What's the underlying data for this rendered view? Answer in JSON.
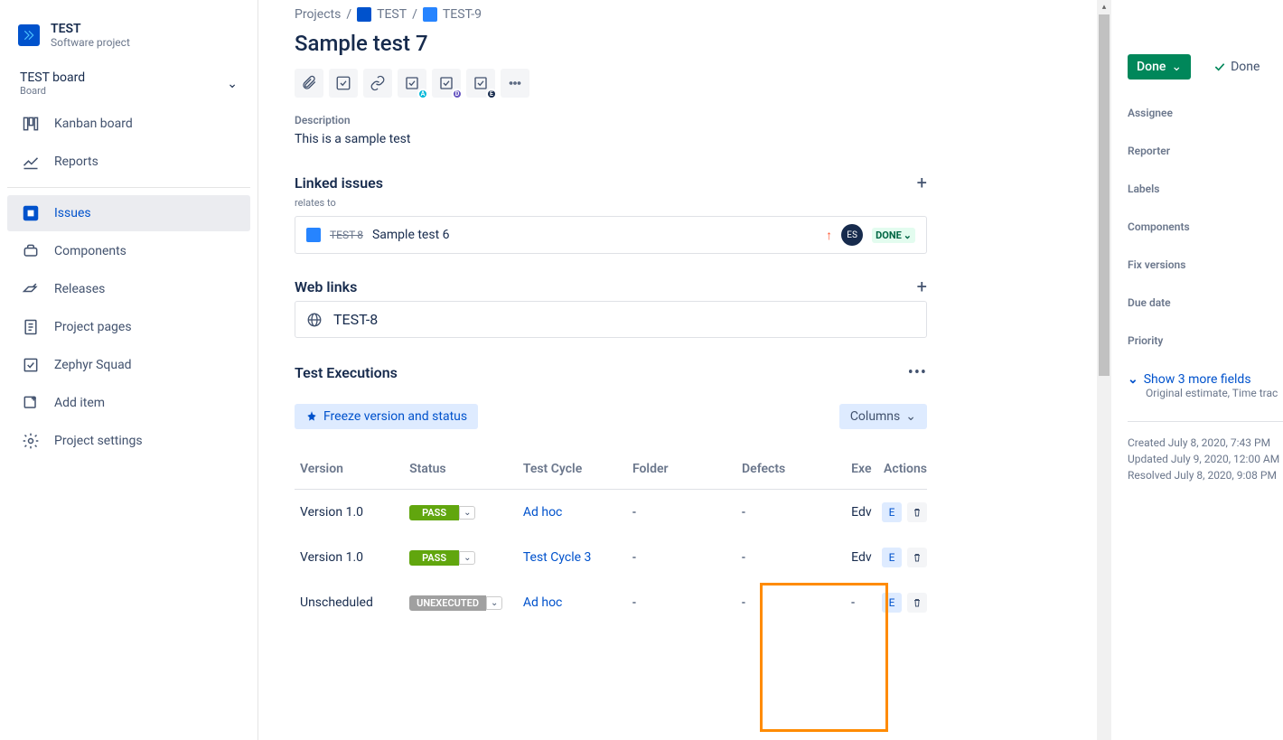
{
  "sidebar": {
    "project_name": "TEST",
    "project_type": "Software project",
    "board_name": "TEST board",
    "board_sub": "Board",
    "nav": {
      "kanban": "Kanban board",
      "reports": "Reports",
      "issues": "Issues",
      "components": "Components",
      "releases": "Releases",
      "pages": "Project pages",
      "zephyr": "Zephyr Squad",
      "add": "Add item",
      "settings": "Project settings"
    }
  },
  "breadcrumb": {
    "projects": "Projects",
    "project": "TEST",
    "issue": "TEST-9"
  },
  "issue": {
    "title": "Sample test 7",
    "description_label": "Description",
    "description": "This is a sample test"
  },
  "linked": {
    "header": "Linked issues",
    "relation": "relates to",
    "item": {
      "key": "TEST-8",
      "summary": "Sample test 6",
      "avatar": "ES",
      "status": "DONE"
    }
  },
  "weblinks": {
    "header": "Web links",
    "item": "TEST-8"
  },
  "executions": {
    "header": "Test Executions",
    "freeze": "Freeze version and status",
    "columns": "Columns",
    "headers": {
      "version": "Version",
      "status": "Status",
      "cycle": "Test Cycle",
      "folder": "Folder",
      "defects": "Defects",
      "exec": "Exe",
      "actions": "Actions"
    },
    "rows": [
      {
        "version": "Version 1.0",
        "status": "PASS",
        "status_class": "pass",
        "cycle": "Ad hoc",
        "folder": "-",
        "defects": "-",
        "exec": "Edv"
      },
      {
        "version": "Version 1.0",
        "status": "PASS",
        "status_class": "pass",
        "cycle": "Test Cycle 3",
        "folder": "-",
        "defects": "-",
        "exec": "Edv"
      },
      {
        "version": "Unscheduled",
        "status": "UNEXECUTED",
        "status_class": "unexec",
        "cycle": "Ad hoc",
        "folder": "-",
        "defects": "-",
        "exec": "-"
      }
    ],
    "action_e": "E"
  },
  "right": {
    "done_button": "Done",
    "done_label": "Done",
    "fields": {
      "assignee": "Assignee",
      "reporter": "Reporter",
      "labels": "Labels",
      "components": "Components",
      "fix": "Fix versions",
      "due": "Due date",
      "priority": "Priority"
    },
    "show_more": "Show 3 more fields",
    "show_more_sub": "Original estimate, Time trac",
    "dates": {
      "created": "Created July 8, 2020, 7:43 PM",
      "updated": "Updated July 9, 2020, 12:00 AM",
      "resolved": "Resolved July 8, 2020, 9:08 PM"
    }
  }
}
